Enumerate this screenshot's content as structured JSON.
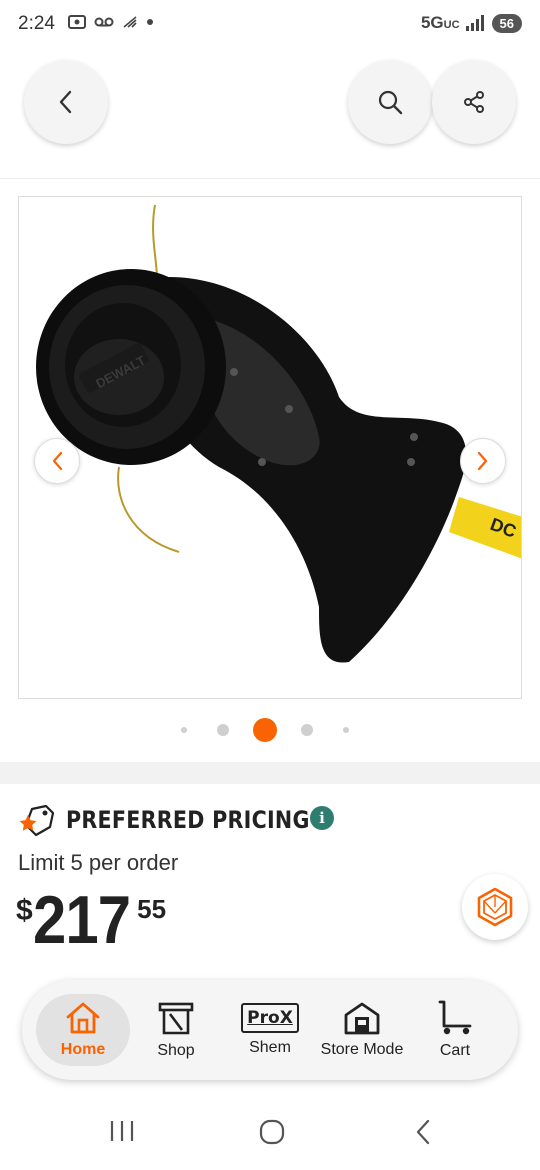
{
  "status_bar": {
    "time": "2:24",
    "network": "5G",
    "network_sub": "UC",
    "battery": "56"
  },
  "header": {
    "back_icon": "chevron-left-icon",
    "search_icon": "search-icon",
    "share_icon": "share-icon"
  },
  "gallery": {
    "image_alt": "String trimmer head product image",
    "prev_icon": "chevron-left-icon",
    "next_icon": "chevron-right-icon",
    "active_index": 2,
    "dot_count": 5
  },
  "pricing": {
    "badge_icon": "star-tag-icon",
    "title": "PREFERRED PRICING",
    "info_symbol": "i",
    "limit": "Limit 5 per order",
    "currency": "$",
    "price_main": "217",
    "price_cents": "55"
  },
  "bottom_nav": {
    "items": [
      {
        "label": "Home",
        "icon": "home-icon"
      },
      {
        "label": "Shop",
        "icon": "shop-icon"
      },
      {
        "label": "Shem",
        "icon": "prox-icon",
        "icon_text": "ProX"
      },
      {
        "label": "Store Mode",
        "icon": "store-icon"
      },
      {
        "label": "Cart",
        "icon": "cart-icon"
      }
    ]
  },
  "colors": {
    "accent": "#f96302",
    "info": "#2e7d6f"
  }
}
